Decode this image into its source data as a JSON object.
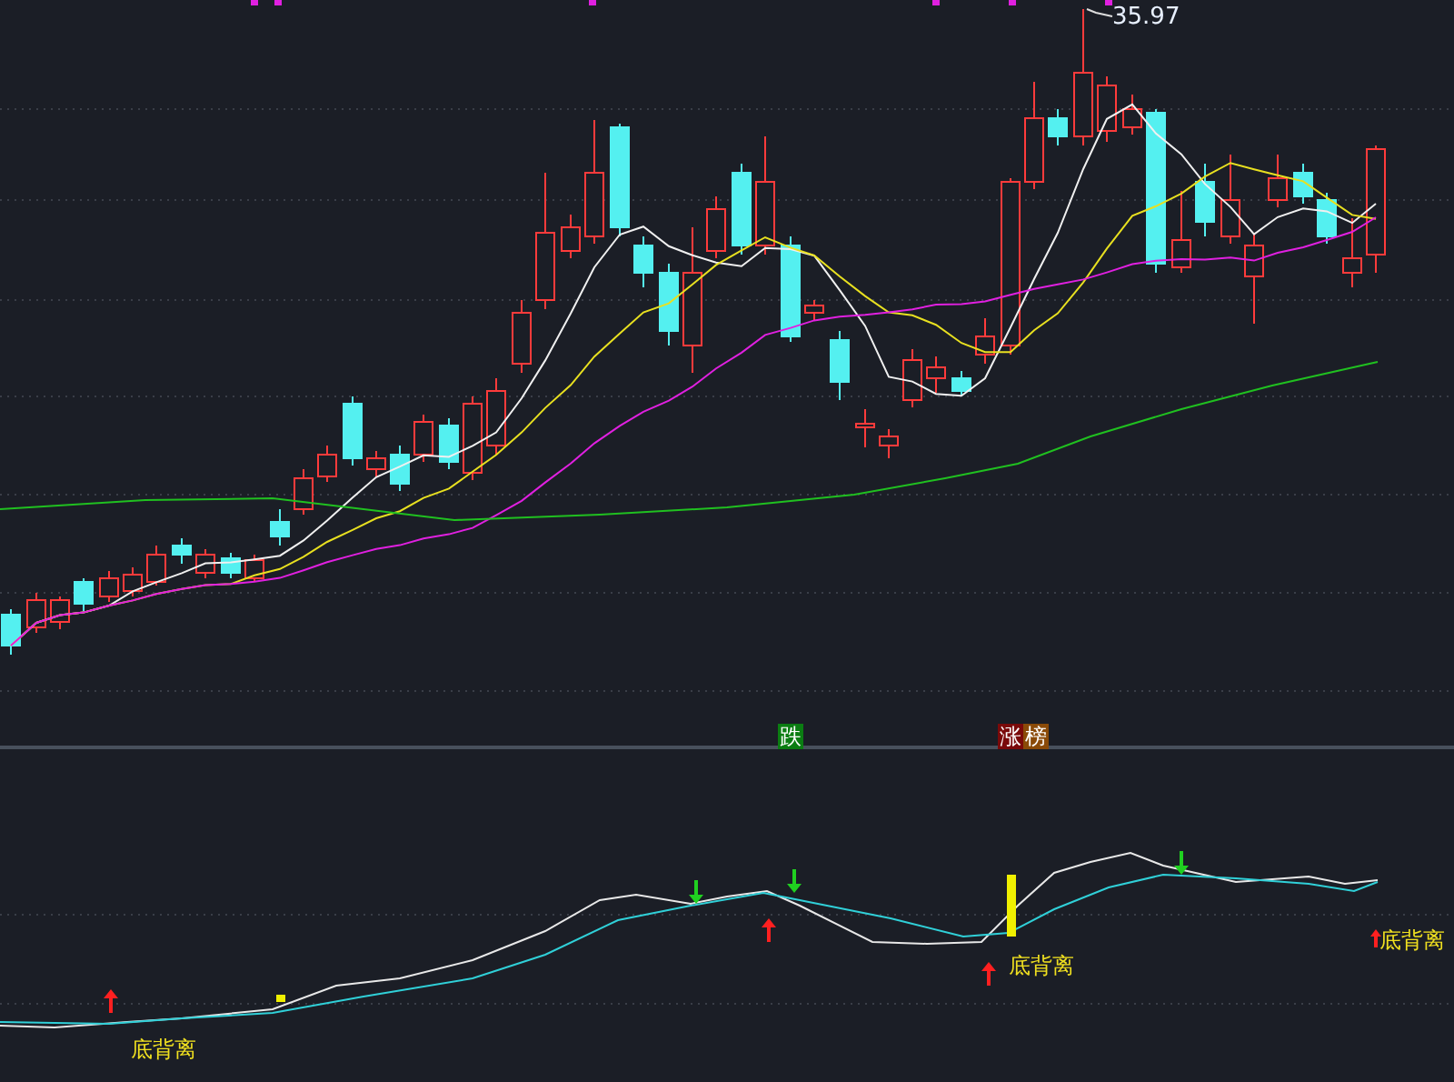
{
  "chart": {
    "high_label": "35.97"
  },
  "tags": [
    {
      "label": "跌",
      "color": "#0b7d12"
    },
    {
      "label": "涨",
      "color": "#7a0a0a"
    },
    {
      "label": "榜",
      "color": "#8a4a08"
    }
  ],
  "divergence_labels": [
    "底背离",
    "底背离",
    "底背离"
  ]
}
